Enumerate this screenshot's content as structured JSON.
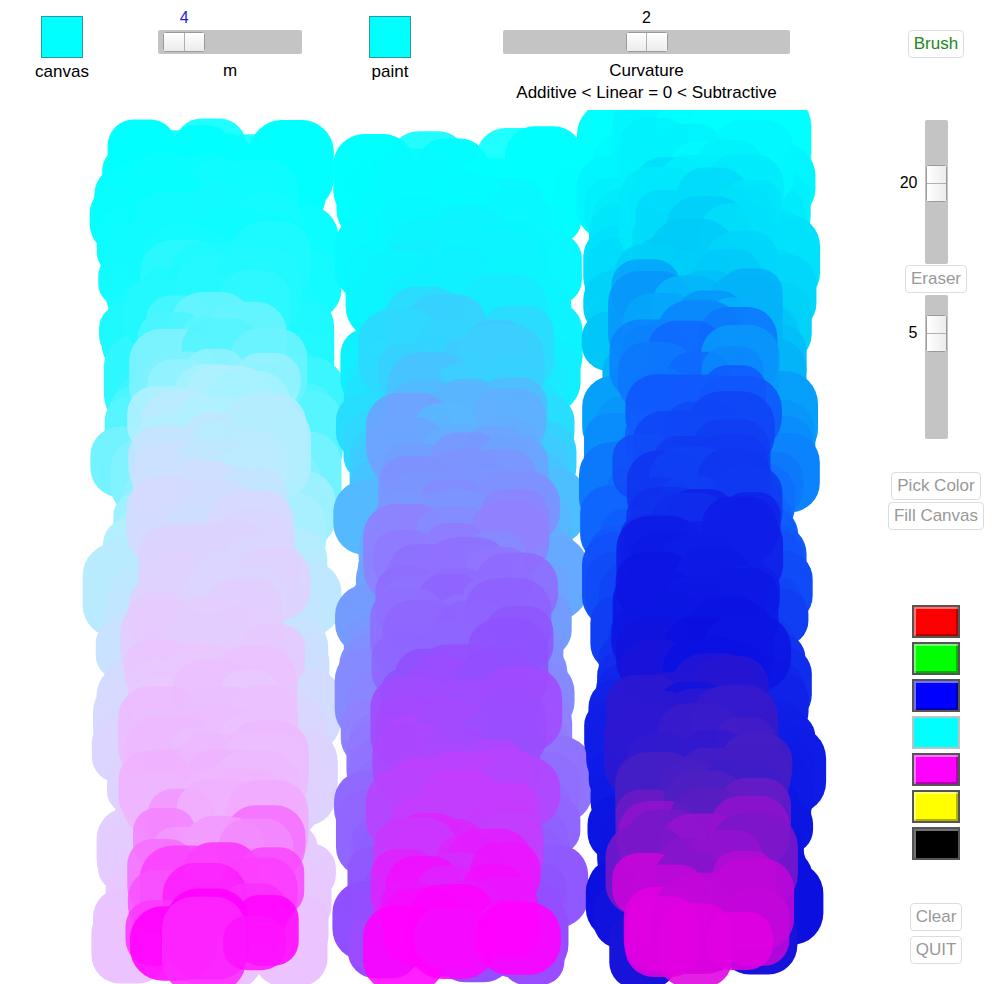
{
  "toolbar": {
    "canvas": {
      "label": "canvas",
      "color": "#00ffff"
    },
    "m_slider": {
      "label": "m",
      "value": "4",
      "level": 0.05,
      "focused": true
    },
    "paint": {
      "label": "paint",
      "color": "#00ffff"
    },
    "curvature_slider": {
      "label": "Curvature",
      "scale": "Additive < Linear = 0 < Subtractive",
      "value": "2",
      "level": 0.5,
      "focused": false
    }
  },
  "paint_columns": [
    {
      "colors": [
        "#00ffff",
        "#20f8ff",
        "#b0f0ff",
        "#d8d8ff",
        "#e8c8ff",
        "#f0b0ff",
        "#ff00ff"
      ]
    },
    {
      "colors": [
        "#00ffff",
        "#10f0ff",
        "#60b0ff",
        "#9080ff",
        "#9050ff",
        "#c040ff",
        "#ff00ff"
      ]
    },
    {
      "colors": [
        "#00ffff",
        "#00c8f8",
        "#1060ff",
        "#1020e8",
        "#0a10e0",
        "#5020c0",
        "#e000e0"
      ]
    }
  ],
  "sidebar": [
    {
      "kind": "button",
      "label": "Brush",
      "active": true
    },
    {
      "kind": "vslider",
      "value": "20",
      "level": 0.42
    },
    {
      "kind": "button",
      "label": "Eraser",
      "active": false
    },
    {
      "kind": "vslider",
      "value": "5",
      "level": 0.19
    },
    {
      "kind": "button",
      "label": "Pick Color",
      "active": false
    },
    {
      "kind": "button",
      "label": "Fill Canvas",
      "active": false
    },
    {
      "kind": "palette",
      "swatches": [
        {
          "color": "#ff0000",
          "selected": false
        },
        {
          "color": "#00ff00",
          "selected": false
        },
        {
          "color": "#0000ff",
          "selected": false
        },
        {
          "color": "#00ffff",
          "selected": true
        },
        {
          "color": "#ff00ff",
          "selected": false
        },
        {
          "color": "#ffff00",
          "selected": false
        },
        {
          "color": "#000000",
          "selected": false
        }
      ]
    },
    {
      "kind": "button",
      "label": "Clear",
      "active": false
    },
    {
      "kind": "button",
      "label": "QUIT",
      "active": false
    }
  ]
}
